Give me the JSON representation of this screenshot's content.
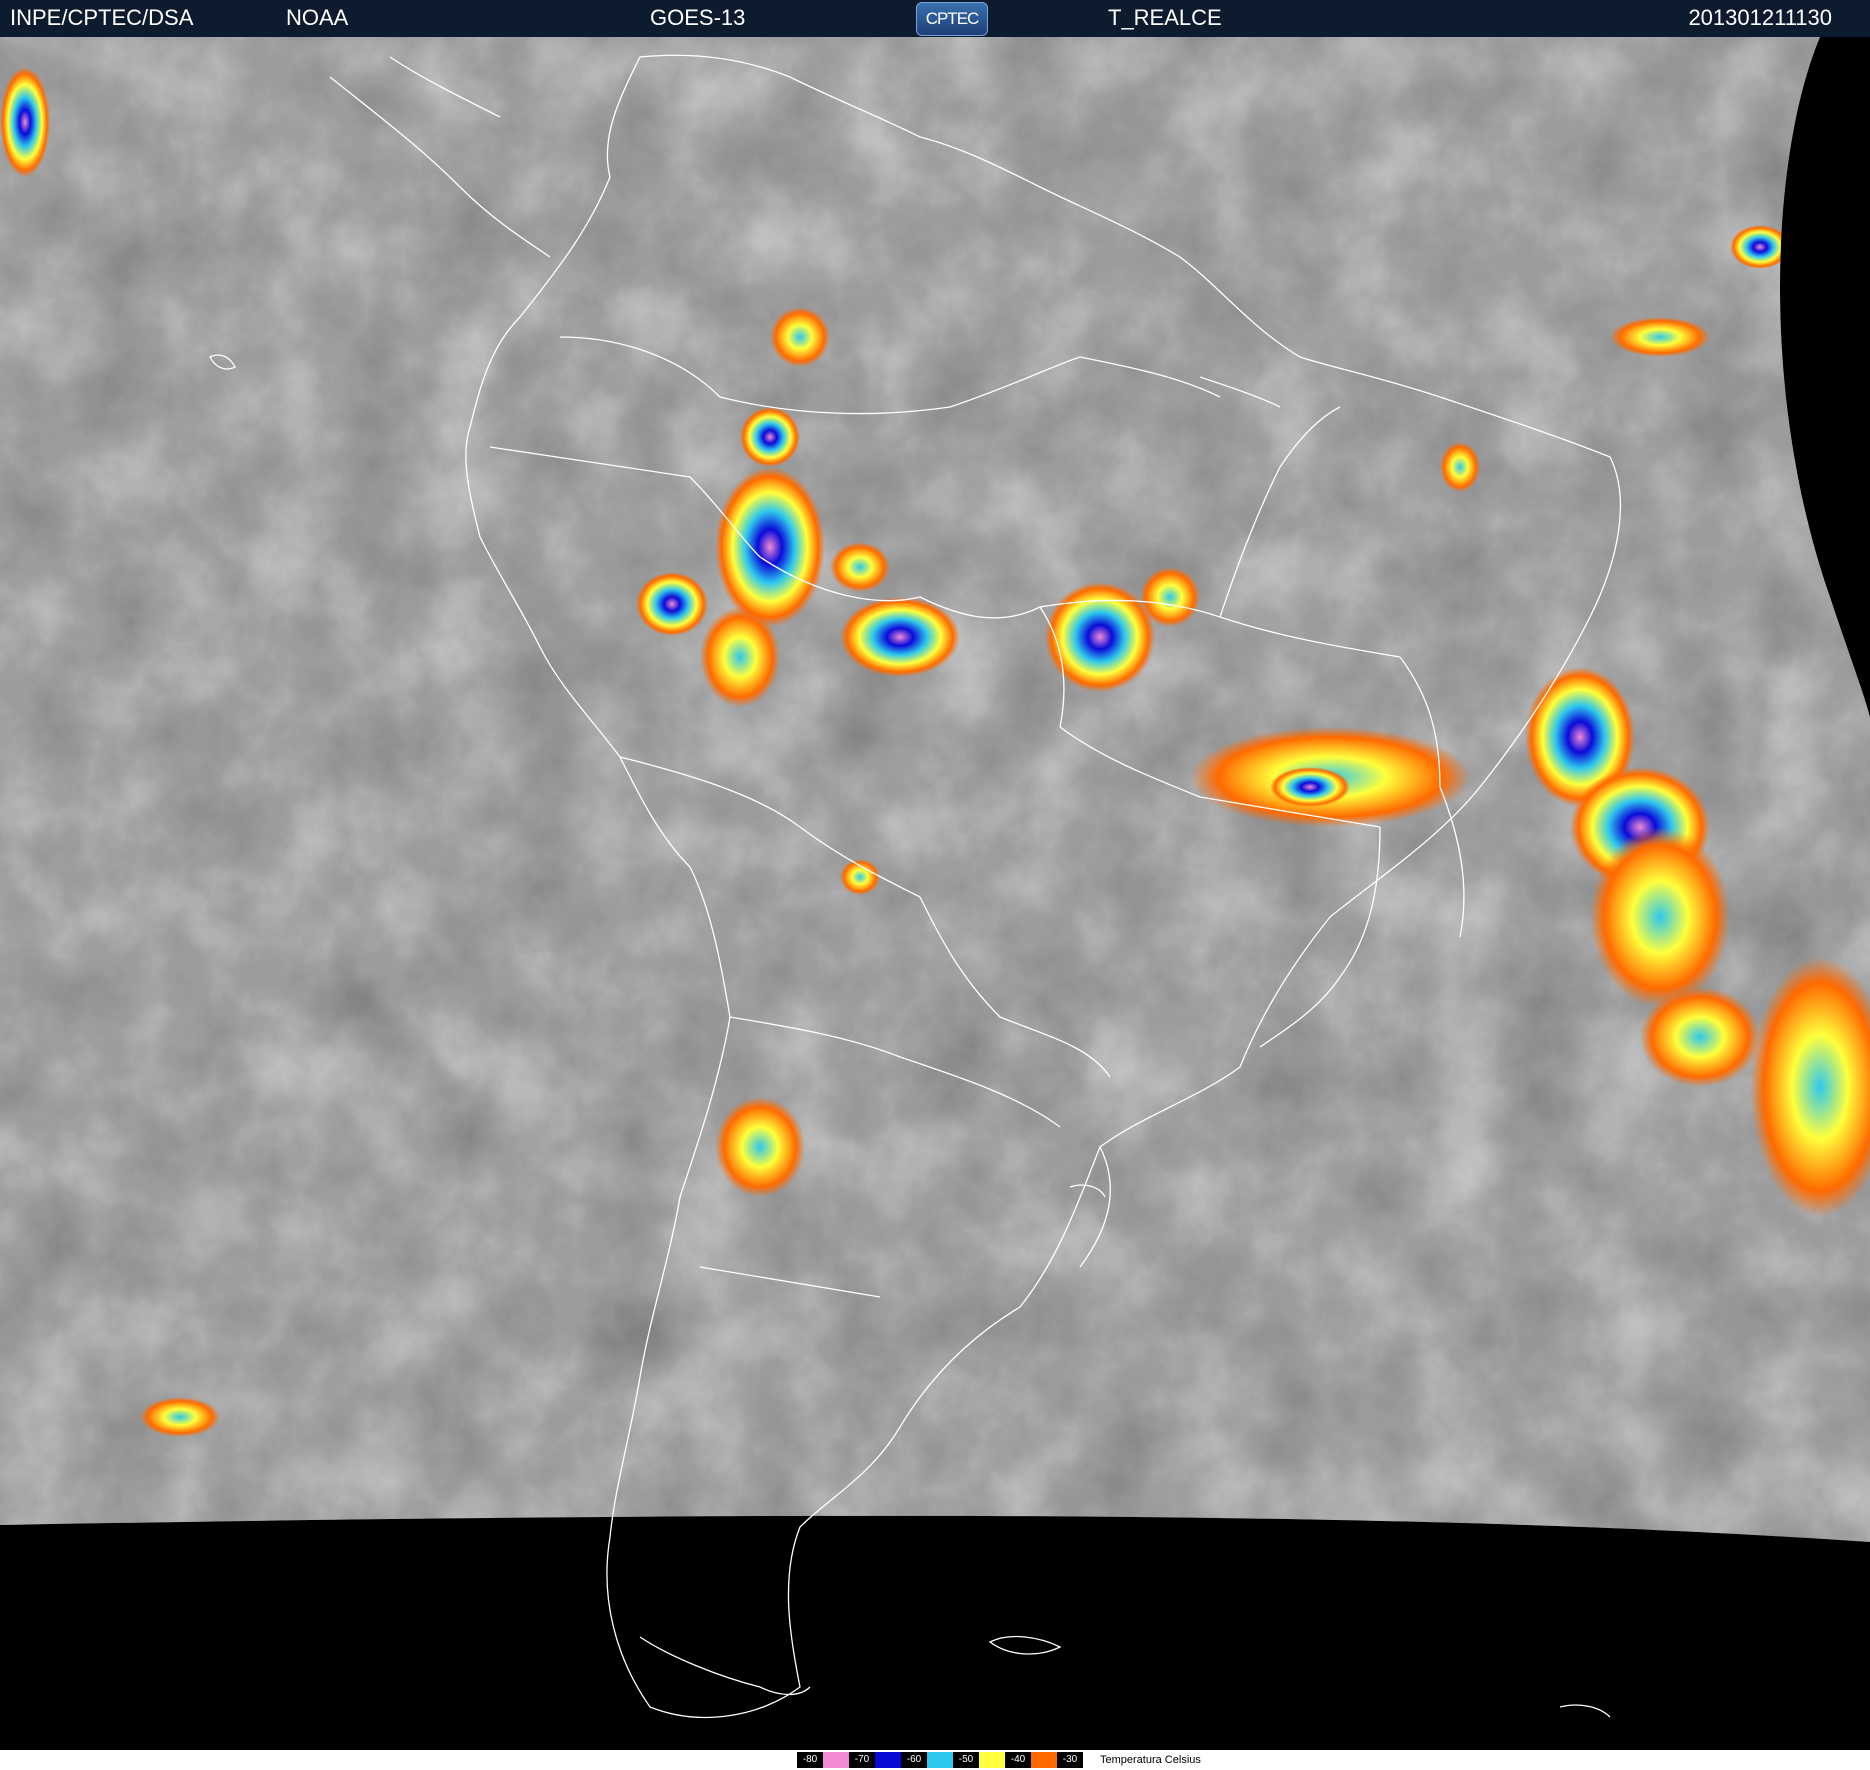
{
  "header": {
    "agency": "INPE/CPTEC/DSA",
    "source": "NOAA",
    "satellite": "GOES-13",
    "logo_text": "CPTEC",
    "product": "T_REALCE",
    "timestamp": "201301211130"
  },
  "map": {
    "background_color": "#585858",
    "space_color": "#000000",
    "border_color": "#ffffff",
    "content": "enhanced infrared satellite image of South America"
  },
  "legend": {
    "title": "Temperatura   Celsius",
    "items": [
      {
        "label": "-80",
        "color": "#f28ad6"
      },
      {
        "label": "-70",
        "color": "#0a0ad8"
      },
      {
        "label": "-60",
        "color": "#2ec8ee"
      },
      {
        "label": "-50",
        "color": "#ffff3c"
      },
      {
        "label": "-40",
        "color": "#ff6a00"
      },
      {
        "label": "-30",
        "color": "#ffffff"
      }
    ]
  }
}
